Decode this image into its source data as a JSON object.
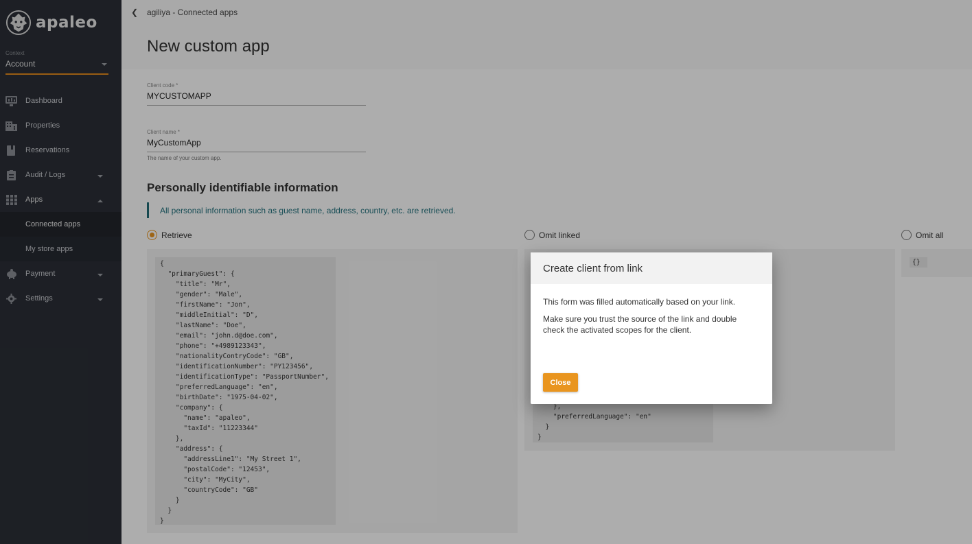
{
  "brand": {
    "name": "apaleo",
    "accent": "#e9951f"
  },
  "context": {
    "label": "Context",
    "value": "Account"
  },
  "nav": {
    "dashboard": "Dashboard",
    "properties": "Properties",
    "reservations": "Reservations",
    "audit": "Audit / Logs",
    "apps": "Apps",
    "connected_apps": "Connected apps",
    "store_apps": "My store apps",
    "payment": "Payment",
    "settings": "Settings"
  },
  "header": {
    "breadcrumb": "agiliya - Connected apps",
    "title": "New custom app"
  },
  "form": {
    "client_code": {
      "label": "Client code *",
      "value": "MYCUSTOMAPP"
    },
    "client_name": {
      "label": "Client name *",
      "value": "MyCustomApp",
      "hint": "The name of your custom app."
    }
  },
  "pii": {
    "title": "Personally identifiable information",
    "info": "All personal information such as guest name, address, country, etc. are retrieved.",
    "options": {
      "retrieve": "Retrieve",
      "omit_linked": "Omit linked",
      "omit_all": "Omit all"
    },
    "selected": "retrieve",
    "retrieve_code": "{\n  \"primaryGuest\": {\n    \"title\": \"Mr\",\n    \"gender\": \"Male\",\n    \"firstName\": \"Jon\",\n    \"middleInitial\": \"D\",\n    \"lastName\": \"Doe\",\n    \"email\": \"john.d@doe.com\",\n    \"phone\": \"+4989123343\",\n    \"nationalityContryCode\": \"GB\",\n    \"identificationNumber\": \"PY123456\",\n    \"identificationType\": \"PassportNumber\",\n    \"preferredLanguage\": \"en\",\n    \"birthDate\": \"1975-04-02\",\n    \"company\": {\n      \"name\": \"apaleo\",\n      \"taxId\": \"11223344\"\n    },\n    \"address\": {\n      \"addressLine1\": \"My Street 1\",\n      \"postalCode\": \"12453\",\n      \"city\": \"MyCity\",\n      \"countryCode\": \"GB\"\n    }\n  }\n}",
    "omit_linked_code_visible": "    },\n    \"preferredLanguage\": \"en\"\n  }\n}",
    "omit_all_code": "{}"
  },
  "dialog": {
    "title": "Create client from link",
    "line1": "This form was filled automatically based on your link.",
    "line2": "Make sure you trust the source of the link and double check the activated scopes for the client.",
    "close_label": "Close"
  }
}
